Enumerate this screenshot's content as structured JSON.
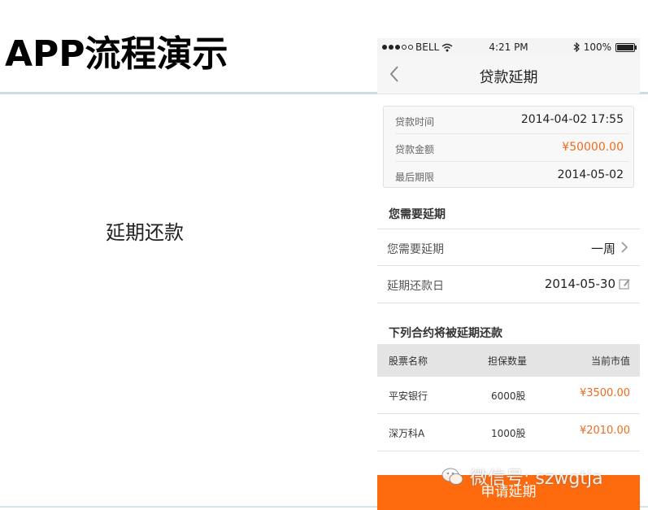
{
  "slide": {
    "title": "APP流程演示",
    "caption": "延期还款"
  },
  "status_bar": {
    "carrier": "BELL",
    "time": "4:21 PM",
    "battery": "100%"
  },
  "nav": {
    "title": "贷款延期"
  },
  "info": [
    {
      "label": "贷款时间",
      "value": "2014-04-02  17:55"
    },
    {
      "label": "贷款金额",
      "value": "¥50000.00"
    },
    {
      "label": "最后期限",
      "value": "2014-05-02"
    }
  ],
  "extension": {
    "header": "您需要延期",
    "duration_label": "您需要延期",
    "duration_value": "一周",
    "date_label": "延期还款日",
    "date_value": "2014-05-30"
  },
  "contracts": {
    "header": "下列合约将被延期还款",
    "columns": [
      "股票名称",
      "担保数量",
      "当前市值"
    ],
    "rows": [
      {
        "name": "平安银行",
        "qty": "6000股",
        "value": "¥3500.00"
      },
      {
        "name": "深万科A",
        "qty": "1000股",
        "value": "¥2010.00"
      }
    ]
  },
  "apply_label": "申请延期",
  "watermark": "微信号: szwgtja",
  "colors": {
    "accent": "#fe6a0e",
    "price": "#f06b1d"
  },
  "icons": {
    "back": "chevron-left-icon",
    "chevron": "chevron-right-icon",
    "edit": "edit-icon",
    "wifi": "wifi-icon",
    "bluetooth": "bluetooth-icon",
    "battery": "battery-icon",
    "wechat": "wechat-icon"
  }
}
